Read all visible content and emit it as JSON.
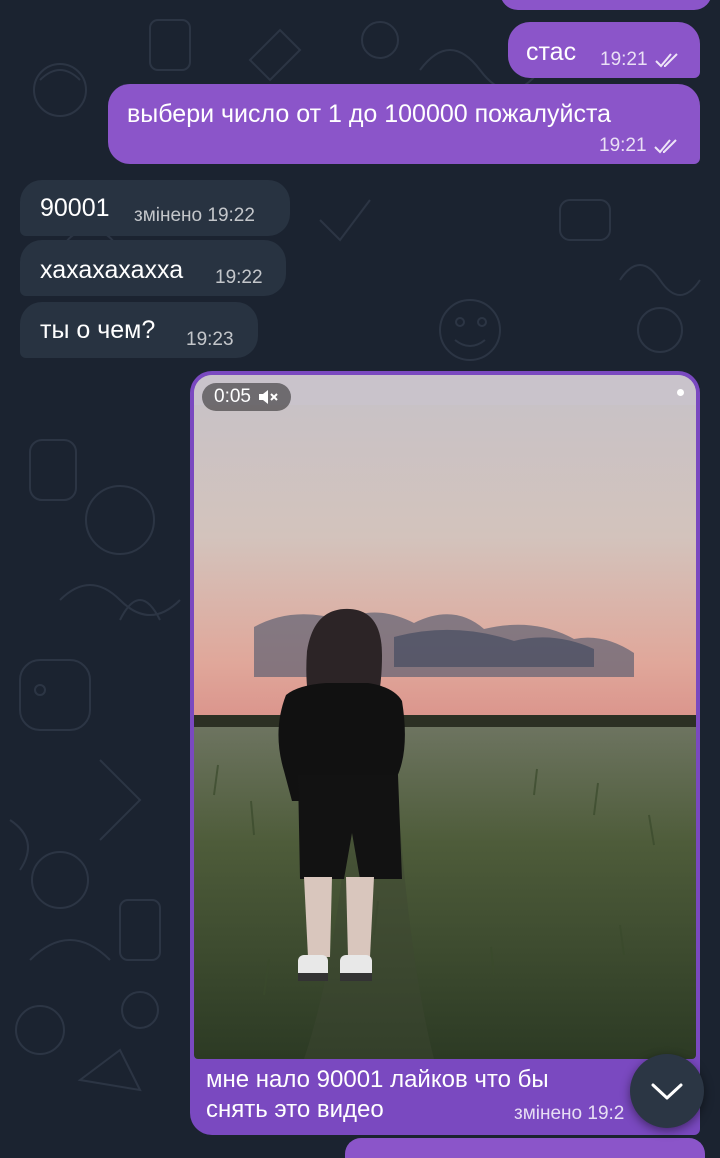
{
  "messages": [
    {
      "text": "стас",
      "time": "19:21"
    },
    {
      "text": "выбери число от 1 до 100000 пожалуйста",
      "time": "19:21"
    },
    {
      "text": "90001",
      "meta": "змінено 19:22"
    },
    {
      "text": "хахахахахха",
      "time": "19:22"
    },
    {
      "text": "ты о чем?",
      "time": "19:23"
    }
  ],
  "video": {
    "duration": "0:05",
    "caption": "мне нало 90001 лайков что бы\nснять это видео",
    "meta": "змінено 19:2"
  },
  "colors": {
    "background": "#1b2330",
    "outgoing_bubble": "#8b55c9",
    "incoming_bubble": "#283341"
  },
  "icons": {
    "read_receipt": "double-check-icon",
    "muted": "speaker-muted-icon",
    "scroll_down": "chevron-down-icon"
  }
}
